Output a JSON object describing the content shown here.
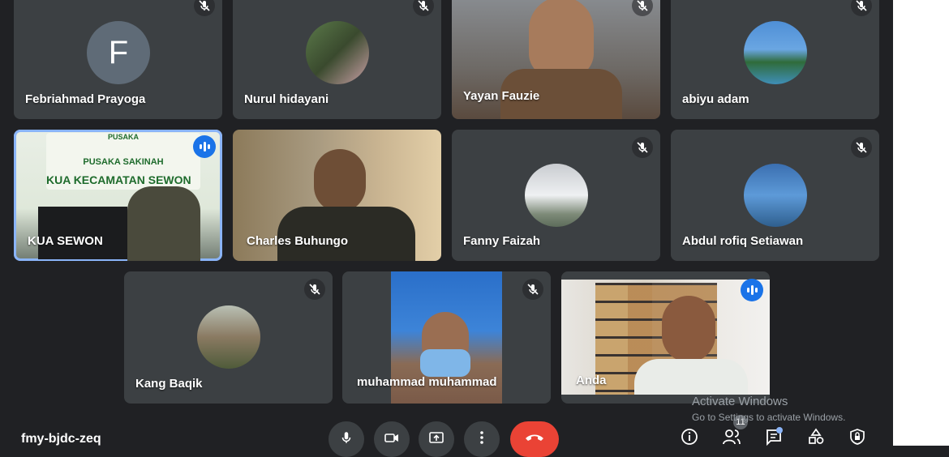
{
  "participants": [
    {
      "name": "Febriahmad Prayoga",
      "initial": "F",
      "muted": true
    },
    {
      "name": "Nurul hidayani",
      "muted": true
    },
    {
      "name": "Yayan Fauzie",
      "muted": true
    },
    {
      "name": "abiyu adam",
      "muted": true
    },
    {
      "name": "KUA SEWON",
      "speaking": true,
      "banner_top": "PUSAKA",
      "banner_mid": "PUSAKA SAKINAH",
      "banner_main": "KUA KECAMATAN SEWON"
    },
    {
      "name": "Charles Buhungo"
    },
    {
      "name": "Fanny Faizah",
      "muted": true
    },
    {
      "name": "Abdul rofiq Setiawan",
      "muted": true
    },
    {
      "name": "Kang Baqik",
      "muted": true
    },
    {
      "name": "muhammad muhammad",
      "muted": true
    },
    {
      "name": "Anda",
      "speaking": true
    }
  ],
  "meeting": {
    "code": "fmy-bjdc-zeq",
    "participant_count": "11"
  },
  "controls": [
    "mic-icon",
    "camera-icon",
    "present-icon",
    "more-icon",
    "end-call-icon"
  ],
  "right_controls": [
    "info-icon",
    "people-icon",
    "chat-icon",
    "activities-icon",
    "host-controls-icon"
  ],
  "watermark": {
    "title": "Activate Windows",
    "subtitle": "Go to Settings to activate Windows."
  },
  "colors": {
    "background": "#202124",
    "tile": "#3c4043",
    "speaking": "#1a73e8",
    "end_call": "#ea4335"
  }
}
